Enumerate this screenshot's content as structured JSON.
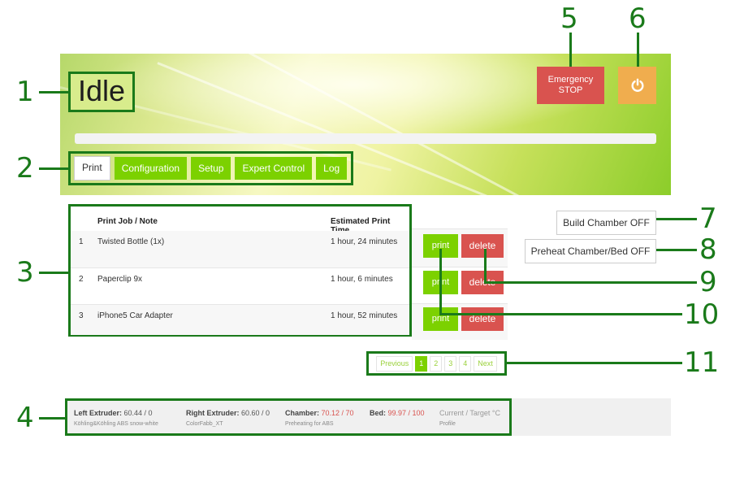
{
  "status": {
    "title": "Idle"
  },
  "header": {
    "emergency_stop": "Emergency\nSTOP",
    "power_icon": "power-icon"
  },
  "tabs": [
    "Print",
    "Configuration",
    "Setup",
    "Expert Control",
    "Log"
  ],
  "jobs": {
    "columns": [
      "Print Job / Note",
      "Estimated Print Time"
    ],
    "rows": [
      {
        "index": "1",
        "name": "Twisted Bottle (1x)",
        "time": "1 hour, 24 minutes"
      },
      {
        "index": "2",
        "name": "Paperclip 9x",
        "time": "1 hour, 6 minutes"
      },
      {
        "index": "3",
        "name": "iPhone5 Car Adapter",
        "time": "1 hour, 52 minutes"
      }
    ],
    "print_label": "print",
    "delete_label": "delete"
  },
  "side_buttons": {
    "build_chamber": "Build Chamber OFF",
    "preheat": "Preheat Chamber/Bed OFF"
  },
  "pagination": {
    "previous": "Previous",
    "pages": [
      "1",
      "2",
      "3",
      "4"
    ],
    "next": "Next",
    "current": "1"
  },
  "temperatures": {
    "left_extruder": {
      "label": "Left Extruder:",
      "value": "60.44 / 0",
      "sub": "Köhling&Köhling ABS snow-white"
    },
    "right_extruder": {
      "label": "Right Extruder:",
      "value": "60.60 / 0",
      "sub": "ColorFabb_XT"
    },
    "chamber": {
      "label": "Chamber:",
      "value": "70.12 / 70",
      "sub": "Preheating for ABS"
    },
    "bed": {
      "label": "Bed:",
      "value": "99.97 / 100"
    },
    "legend": {
      "value": "Current / Target °C",
      "sub": "Profile"
    }
  },
  "callouts": [
    "1",
    "2",
    "3",
    "4",
    "5",
    "6",
    "7",
    "8",
    "9",
    "10",
    "11"
  ],
  "colors": {
    "green": "#7cd100",
    "red": "#d9534f",
    "orange": "#f0ad4e",
    "annotation": "#1a7a1a"
  }
}
